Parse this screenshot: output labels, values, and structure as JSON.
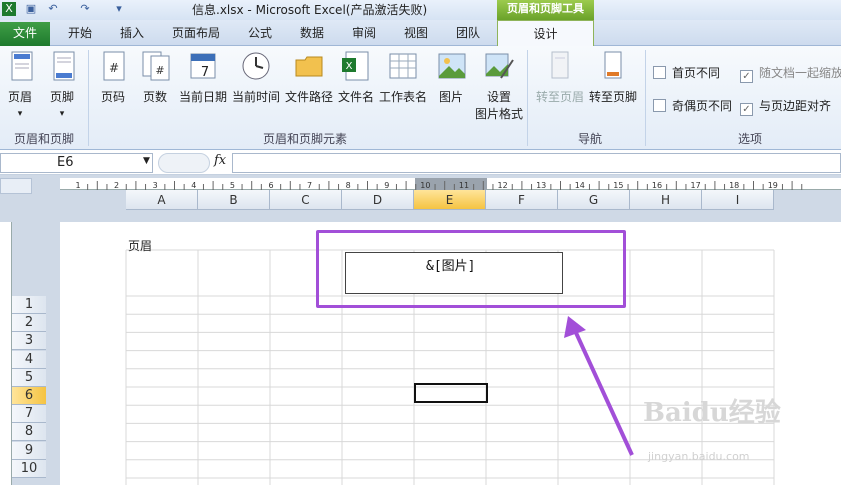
{
  "window": {
    "title": "信息.xlsx - Microsoft Excel(产品激活失败)",
    "context_header": "页眉和页脚工具"
  },
  "tabs": {
    "file": "文件",
    "items": [
      "开始",
      "插入",
      "页面布局",
      "公式",
      "数据",
      "审阅",
      "视图",
      "团队"
    ],
    "design": "设计"
  },
  "ribbon": {
    "group1": {
      "label": "页眉和页脚",
      "buttons": [
        "页眉",
        "页脚"
      ]
    },
    "group2": {
      "label": "页眉和页脚元素",
      "buttons": [
        "页码",
        "页数",
        "当前日期",
        "当前时间",
        "文件路径",
        "文件名",
        "工作表名",
        "图片",
        "设置",
        "图片格式"
      ]
    },
    "group3": {
      "label": "导航",
      "buttons": [
        "转至页眉",
        "转至页脚"
      ]
    },
    "group4": {
      "label": "选项",
      "options": [
        "首页不同",
        "随文档一起缩放",
        "奇偶页不同",
        "与页边距对齐"
      ],
      "checked": [
        false,
        true,
        false,
        true
      ]
    }
  },
  "formula_bar": {
    "name_box": "E6",
    "fx": "fx",
    "formula": ""
  },
  "sheet": {
    "columns": [
      "A",
      "B",
      "C",
      "D",
      "E",
      "F",
      "G",
      "H",
      "I"
    ],
    "selected_column": "E",
    "rows": [
      "1",
      "2",
      "3",
      "4",
      "5",
      "6",
      "7",
      "8",
      "9",
      "10"
    ],
    "selected_row": "6",
    "ruler_marks": [
      "1",
      "2",
      "3",
      "4",
      "5",
      "6",
      "7",
      "8",
      "9",
      "10",
      "11",
      "12",
      "13",
      "14",
      "15",
      "16",
      "17",
      "18",
      "19"
    ],
    "header_label": "页眉",
    "header_content": "&[图片]"
  },
  "watermark": {
    "brand": "Baidu经验",
    "url": "jingyan.baidu.com"
  },
  "colors": {
    "accent": "#a24fd8",
    "file_tab": "#1e7a2e",
    "context_tab": "#6aa22a",
    "selection": "#f5c342"
  }
}
